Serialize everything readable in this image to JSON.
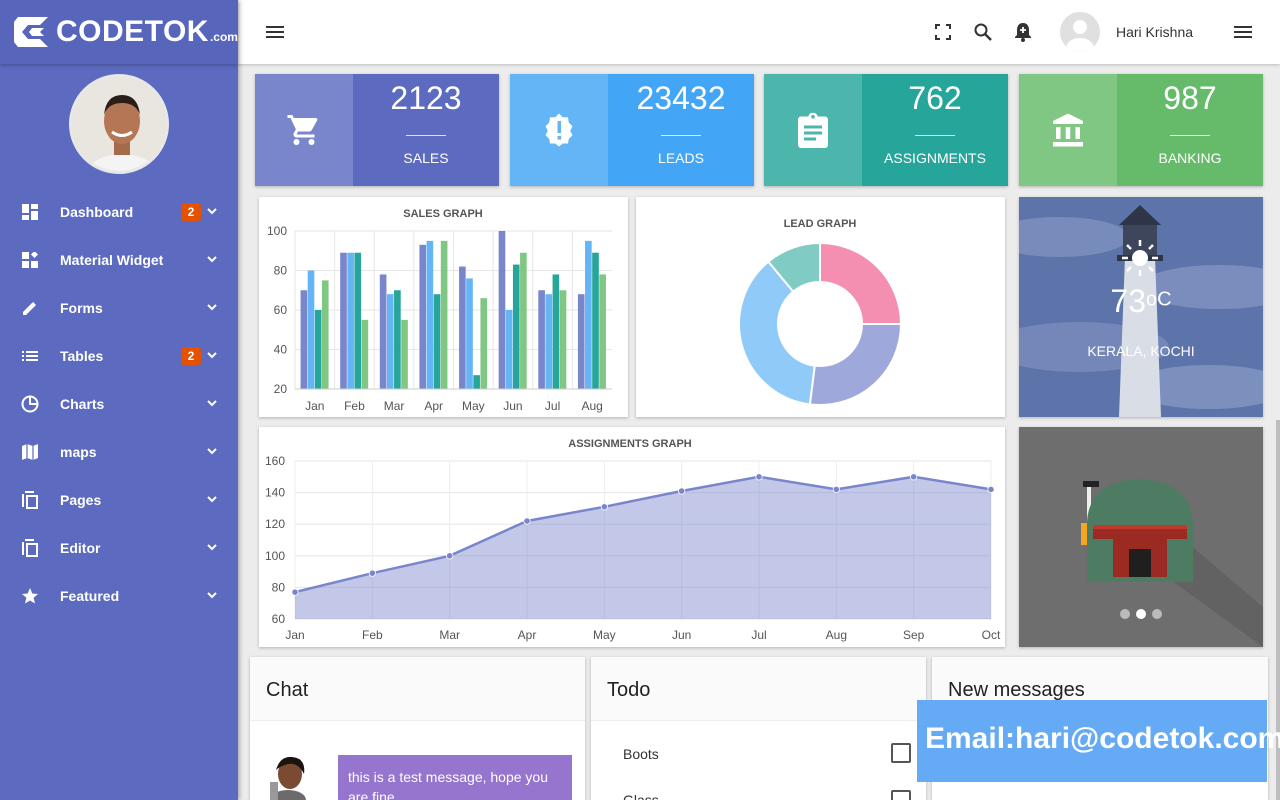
{
  "brand": {
    "name": "CODETOK",
    "suffix": ".com"
  },
  "sidebar": {
    "items": [
      {
        "label": "Dashboard",
        "icon": "dashboard-icon",
        "badge": "2"
      },
      {
        "label": "Material Widget",
        "icon": "widgets-icon"
      },
      {
        "label": "Forms",
        "icon": "pencil-icon"
      },
      {
        "label": "Tables",
        "icon": "list-icon",
        "badge": "2"
      },
      {
        "label": "Charts",
        "icon": "pie-chart-icon"
      },
      {
        "label": "maps",
        "icon": "map-icon"
      },
      {
        "label": "Pages",
        "icon": "copy-icon"
      },
      {
        "label": "Editor",
        "icon": "copy-icon"
      },
      {
        "label": "Featured",
        "icon": "star-icon"
      }
    ]
  },
  "topbar": {
    "user_name": "Hari Krishna"
  },
  "stats": [
    {
      "value": "2123",
      "label": "SALES",
      "icon": "cart-icon",
      "color_light": "#7986cb",
      "color_dark": "#5c6bc0"
    },
    {
      "value": "23432",
      "label": "LEADS",
      "icon": "alert-badge-icon",
      "color_light": "#64b5f6",
      "color_dark": "#42a5f5"
    },
    {
      "value": "762",
      "label": "ASSIGNMENTS",
      "icon": "clipboard-icon",
      "color_light": "#4db6ac",
      "color_dark": "#26a69a"
    },
    {
      "value": "987",
      "label": "BANKING",
      "icon": "bank-icon",
      "color_light": "#81c784",
      "color_dark": "#66bb6a"
    }
  ],
  "chart_data": [
    {
      "type": "bar",
      "title": "SALES GRAPH",
      "categories": [
        "Jan",
        "Feb",
        "Mar",
        "Apr",
        "May",
        "Jun",
        "Jul",
        "Aug"
      ],
      "ylim": [
        20,
        100
      ],
      "yticks": [
        20,
        40,
        60,
        80,
        100
      ],
      "colors": [
        "#7986cb",
        "#64b5f6",
        "#26a69a",
        "#81c784"
      ],
      "series": [
        {
          "values": [
            70,
            89,
            78,
            93,
            82,
            100,
            70,
            68
          ]
        },
        {
          "values": [
            80,
            89,
            68,
            95,
            76,
            60,
            68,
            95
          ]
        },
        {
          "values": [
            60,
            89,
            70,
            68,
            27,
            83,
            78,
            89
          ]
        },
        {
          "values": [
            75,
            55,
            55,
            95,
            66,
            89,
            70,
            78
          ]
        }
      ]
    },
    {
      "type": "pie",
      "title": "LEAD GRAPH",
      "values": [
        25,
        27,
        37,
        11
      ],
      "colors": [
        "#f48fb1",
        "#9fa8da",
        "#90caf9",
        "#80cbc4"
      ]
    },
    {
      "type": "area",
      "title": "ASSIGNMENTS GRAPH",
      "x": [
        "Jan",
        "Feb",
        "Mar",
        "Apr",
        "May",
        "Jun",
        "Jul",
        "Aug",
        "Sep",
        "Oct"
      ],
      "values": [
        77,
        89,
        100,
        122,
        131,
        141,
        150,
        142,
        150,
        142
      ],
      "ylim": [
        60,
        160
      ],
      "yticks": [
        60,
        80,
        100,
        120,
        140,
        160
      ],
      "color": "#7986cb"
    }
  ],
  "weather": {
    "temp": "73",
    "unit": "oC",
    "location": "KERALA, KOCHI"
  },
  "slider": {
    "dots": 3,
    "active": 1
  },
  "cards": {
    "chat": {
      "title": "Chat",
      "message": "this is a test message, hope you are fine"
    },
    "todo": {
      "title": "Todo",
      "items": [
        "Boots",
        "Glass"
      ]
    },
    "messages": {
      "title": "New messages"
    }
  },
  "banner": {
    "text": "Email:hari@codetok.com"
  }
}
